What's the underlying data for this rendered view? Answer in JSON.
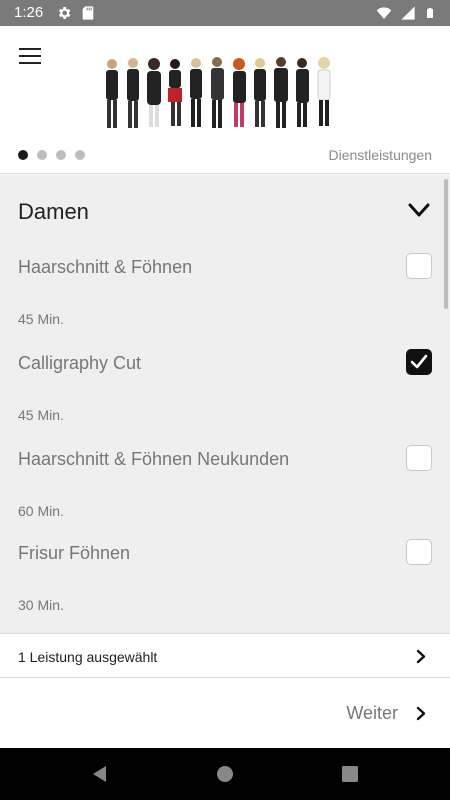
{
  "status_bar": {
    "time": "1:26",
    "left_icons": [
      "gear-icon",
      "sd-card-icon"
    ],
    "right_icons": [
      "wifi-icon",
      "signal-icon",
      "battery-icon"
    ],
    "background": "#7a7a7a"
  },
  "header": {
    "caption": "Dienstleistungen",
    "carousel_dots": 4,
    "active_dot": 0
  },
  "category": {
    "title": "Damen",
    "expanded": true
  },
  "services": [
    {
      "name": "Haarschnitt & Föhnen",
      "duration": "45 Min.",
      "checked": false
    },
    {
      "name": "Calligraphy Cut",
      "duration": "45 Min.",
      "checked": true
    },
    {
      "name": "Haarschnitt & Föhnen Neukunden",
      "duration": "60 Min.",
      "checked": false
    },
    {
      "name": "Frisur Föhnen",
      "duration": "30 Min.",
      "checked": false
    }
  ],
  "selection_summary": "1 Leistung ausgewählt",
  "next_label": "Weiter",
  "colors": {
    "list_background": "#efefef",
    "checkbox_checked": "#111111",
    "secondary_text": "#777777"
  }
}
